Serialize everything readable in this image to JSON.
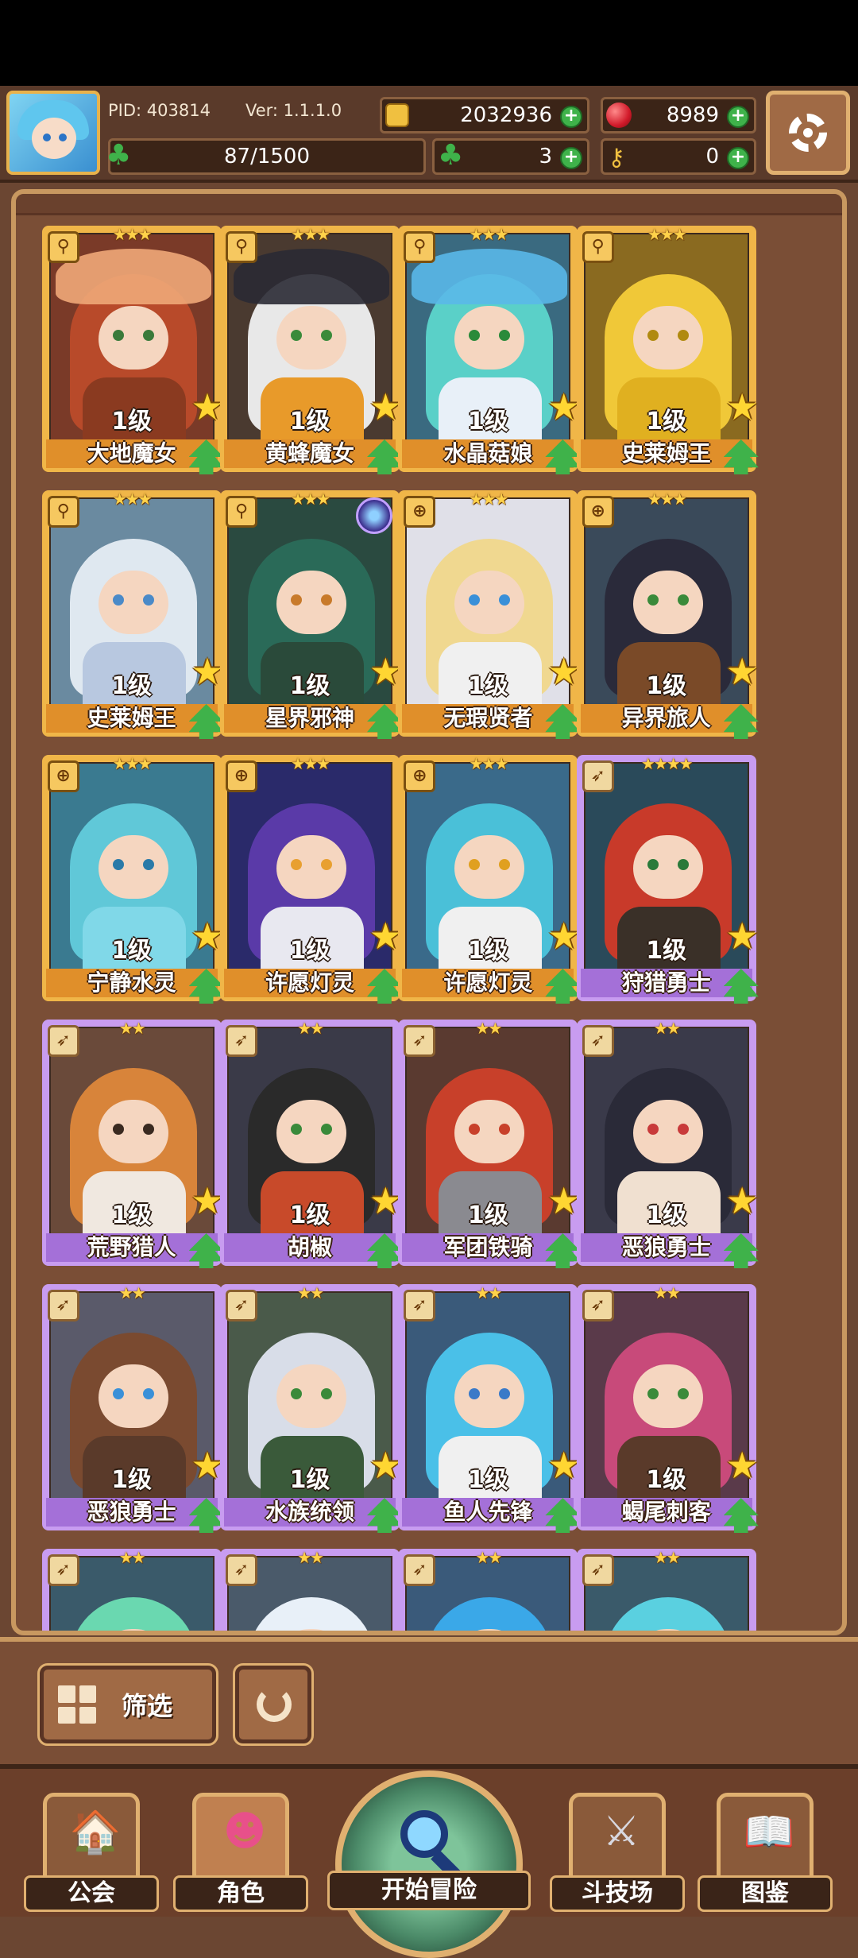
{
  "header": {
    "pid": "PID: 403814",
    "version": "Ver: 1.1.1.0",
    "gold": "2032936",
    "gems": "8989",
    "stamina": "87/1500",
    "clover": "3",
    "keys": "0"
  },
  "roster": [
    {
      "name": "大地魔女",
      "level": "1级",
      "stars": "★★★",
      "frame": "gold",
      "badge": "sword"
    },
    {
      "name": "黄蜂魔女",
      "level": "1级",
      "stars": "★★★",
      "frame": "gold",
      "badge": "sword"
    },
    {
      "name": "水晶菇娘",
      "level": "1级",
      "stars": "★★★",
      "frame": "gold",
      "badge": "sword"
    },
    {
      "name": "史莱姆王",
      "level": "1级",
      "stars": "★★★",
      "frame": "gold",
      "badge": "sword"
    },
    {
      "name": "史莱姆王",
      "level": "1级",
      "stars": "★★★",
      "frame": "gold",
      "badge": "sword"
    },
    {
      "name": "星界邪神",
      "level": "1级",
      "stars": "★★★",
      "frame": "gold",
      "badge": "sword"
    },
    {
      "name": "无瑕贤者",
      "level": "1级",
      "stars": "★★★",
      "frame": "gold",
      "badge": "target"
    },
    {
      "name": "异界旅人",
      "level": "1级",
      "stars": "★★★",
      "frame": "gold",
      "badge": "target"
    },
    {
      "name": "宁静水灵",
      "level": "1级",
      "stars": "★★★",
      "frame": "gold",
      "badge": "target"
    },
    {
      "name": "许愿灯灵",
      "level": "1级",
      "stars": "★★★",
      "frame": "gold",
      "badge": "target"
    },
    {
      "name": "许愿灯灵",
      "level": "1级",
      "stars": "★★★",
      "frame": "gold",
      "badge": "target"
    },
    {
      "name": "狩猎勇士",
      "level": "1级",
      "stars": "★★★★",
      "frame": "purple",
      "badge": "blade"
    },
    {
      "name": "荒野猎人",
      "level": "1级",
      "stars": "★★",
      "frame": "purple",
      "badge": "blade"
    },
    {
      "name": "胡椒",
      "level": "1级",
      "stars": "★★",
      "frame": "purple",
      "badge": "blade"
    },
    {
      "name": "军团铁骑",
      "level": "1级",
      "stars": "★★",
      "frame": "purple",
      "badge": "blade"
    },
    {
      "name": "恶狼勇士",
      "level": "1级",
      "stars": "★★",
      "frame": "purple",
      "badge": "blade"
    },
    {
      "name": "恶狼勇士",
      "level": "1级",
      "stars": "★★",
      "frame": "purple",
      "badge": "blade"
    },
    {
      "name": "水族统领",
      "level": "1级",
      "stars": "★★",
      "frame": "purple",
      "badge": "blade"
    },
    {
      "name": "鱼人先锋",
      "level": "1级",
      "stars": "★★",
      "frame": "purple",
      "badge": "blade"
    },
    {
      "name": "蝎尾刺客",
      "level": "1级",
      "stars": "★★",
      "frame": "purple",
      "badge": "blade"
    },
    {
      "name": "",
      "level": "",
      "stars": "★★",
      "frame": "purple",
      "badge": "blade"
    },
    {
      "name": "",
      "level": "",
      "stars": "★★",
      "frame": "purple",
      "badge": "blade"
    },
    {
      "name": "",
      "level": "",
      "stars": "★★",
      "frame": "purple",
      "badge": "blade"
    },
    {
      "name": "",
      "level": "",
      "stars": "★★",
      "frame": "purple",
      "badge": "blade"
    }
  ],
  "filter": {
    "label": "筛选"
  },
  "nav": {
    "guild": "公会",
    "character": "角色",
    "adventure": "开始冒险",
    "arena": "斗技场",
    "codex": "图鉴"
  },
  "colors": {
    "gold_frame": "#f0b648",
    "purple_frame": "#c89cf0",
    "plus_green": "#3fb24a"
  },
  "icons": [
    "avatar",
    "coin-icon",
    "gem-icon",
    "clover-icon",
    "key-icon",
    "gear-icon",
    "star-icon",
    "upgrade-arrow-icon",
    "filter-grid-icon",
    "refresh-icon",
    "guild-icon",
    "character-icon",
    "magnifier-icon",
    "swords-icon",
    "book-icon"
  ]
}
